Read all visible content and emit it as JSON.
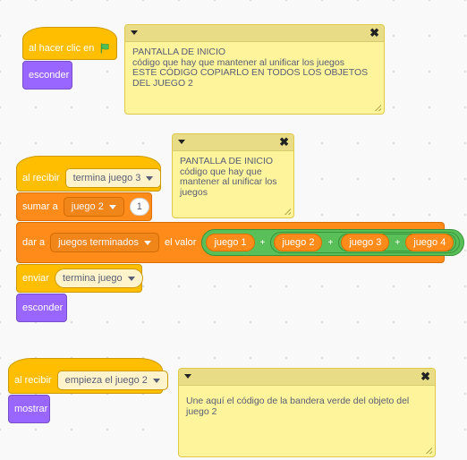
{
  "colors": {
    "events": "#ffbf00",
    "looks": "#9966ff",
    "variables": "#ff8c1a",
    "operators": "#59c059",
    "note": "#fef49c",
    "note_bar": "#e8dd86"
  },
  "script1": {
    "hat_label": "al hacer clic en",
    "flag_icon": "green-flag-icon",
    "hide_label": "esconder",
    "note": {
      "text": "PANTALLA DE INICIO\ncódigo que hay que mantener al unificar los  juegos\nESTE CÓDIGO COPIARLO EN TODOS LOS OBJETOS DEL JUEGO 2"
    }
  },
  "script2": {
    "hat_label": "al recibir",
    "hat_message": "termina juego 3",
    "change_label": "sumar a",
    "change_var": "juego 2",
    "change_value": "1",
    "set_label": "dar a",
    "set_var": "juegos terminados",
    "set_value_label": "el valor",
    "join_items": [
      "juego 1",
      "+",
      "juego 2",
      "+",
      "juego 3",
      "+",
      "juego 4"
    ],
    "broadcast_label": "enviar",
    "broadcast_message": "termina juego",
    "hide_label": "esconder",
    "note": {
      "text": "PANTALLA DE INICIO\ncódigo que hay que mantener al unificar los juegos"
    }
  },
  "script3": {
    "hat_label": "al recibir",
    "hat_message": "empieza el juego 2",
    "show_label": "mostrar",
    "note": {
      "text": "Une aquí el código de la bandera verde del objeto del juego 2"
    }
  }
}
